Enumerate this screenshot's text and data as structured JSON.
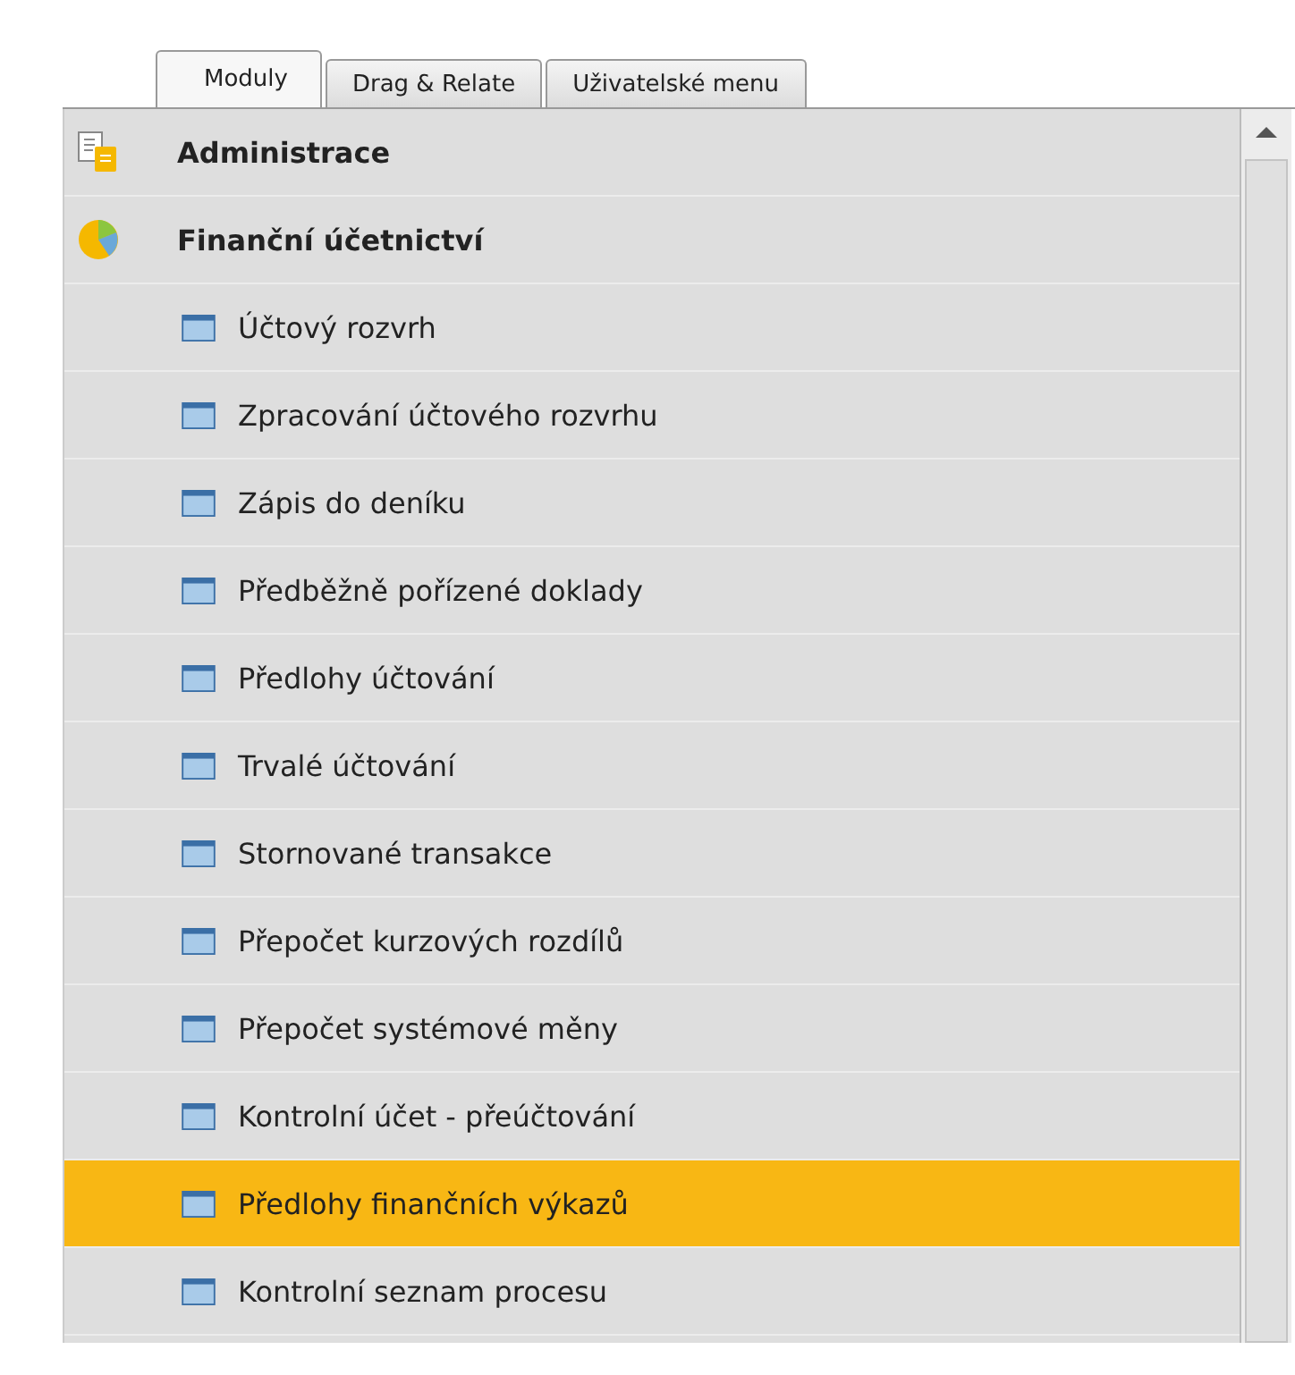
{
  "tabs": [
    {
      "label": "Moduly",
      "selected": true
    },
    {
      "label": "Drag & Relate",
      "selected": false
    },
    {
      "label": "Uživatelské menu",
      "selected": false
    }
  ],
  "modules": [
    {
      "label": "Administrace",
      "kind": "document",
      "selected": false
    },
    {
      "label": "Finanční účetnictví",
      "kind": "chart",
      "selected": false,
      "children": [
        {
          "label": "Účtový rozvrh",
          "selected": false
        },
        {
          "label": "Zpracování účtového rozvrhu",
          "selected": false
        },
        {
          "label": "Zápis do deníku",
          "selected": false
        },
        {
          "label": "Předběžně pořízené doklady",
          "selected": false
        },
        {
          "label": "Předlohy účtování",
          "selected": false
        },
        {
          "label": "Trvalé účtování",
          "selected": false
        },
        {
          "label": "Stornované transakce",
          "selected": false
        },
        {
          "label": "Přepočet kurzových rozdílů",
          "selected": false
        },
        {
          "label": "Přepočet systémové měny",
          "selected": false
        },
        {
          "label": "Kontrolní účet - přeúčtování",
          "selected": false
        },
        {
          "label": "Předlohy finančních výkazů",
          "selected": true
        },
        {
          "label": "Kontrolní seznam procesu",
          "selected": false
        }
      ]
    }
  ]
}
